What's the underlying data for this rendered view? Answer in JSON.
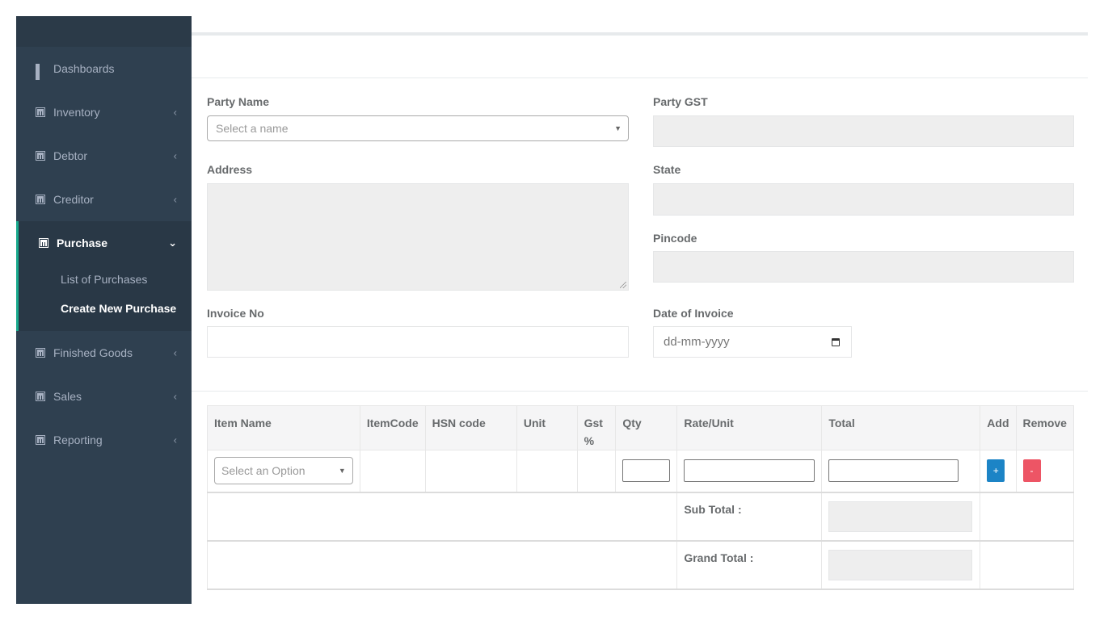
{
  "sidebar": {
    "items": [
      {
        "label": "Dashboards",
        "icon": "grid-icon"
      },
      {
        "label": "Inventory",
        "icon": "calculator-icon"
      },
      {
        "label": "Debtor",
        "icon": "calculator-icon"
      },
      {
        "label": "Creditor",
        "icon": "calculator-icon"
      },
      {
        "label": "Purchase",
        "icon": "calculator-icon",
        "expanded": true,
        "children": [
          {
            "label": "List of Purchases"
          },
          {
            "label": "Create New Purchase",
            "current": true
          }
        ]
      },
      {
        "label": "Finished Goods",
        "icon": "calculator-icon"
      },
      {
        "label": "Sales",
        "icon": "calculator-icon"
      },
      {
        "label": "Reporting",
        "icon": "calculator-icon"
      }
    ],
    "chevron_collapsed": "‹",
    "chevron_expanded": "⌄",
    "accent_color": "#19aa8d",
    "bg_color": "#2f4050"
  },
  "form": {
    "party_name_label": "Party Name",
    "party_name_placeholder": "Select a name",
    "party_gst_label": "Party GST",
    "address_label": "Address",
    "state_label": "State",
    "pincode_label": "Pincode",
    "invoice_no_label": "Invoice No",
    "date_label": "Date of Invoice",
    "date_placeholder": "dd-mm-yyyy"
  },
  "items_table": {
    "headers": [
      "Item Name",
      "ItemCode",
      "HSN code",
      "Unit",
      "Gst %",
      "Qty",
      "Rate/Unit",
      "Total",
      "Add",
      "Remove"
    ],
    "item_placeholder": "Select an Option",
    "add_label": "+",
    "remove_label": "-",
    "subtotal_label": "Sub Total :",
    "grandtotal_label": "Grand Total :",
    "add_color": "#1c84c6",
    "remove_color": "#ed5565"
  }
}
